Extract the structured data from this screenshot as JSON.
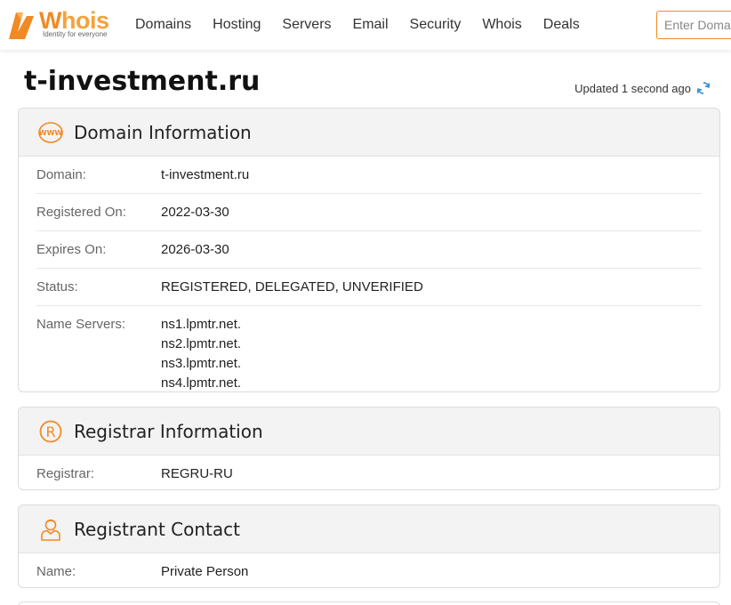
{
  "header": {
    "logo": {
      "brand": "Whois",
      "brand_w": "W",
      "brand_rest": "hois",
      "tagline": "Identity for everyone"
    },
    "nav": [
      {
        "label": "Domains"
      },
      {
        "label": "Hosting"
      },
      {
        "label": "Servers"
      },
      {
        "label": "Email"
      },
      {
        "label": "Security"
      },
      {
        "label": "Whois"
      },
      {
        "label": "Deals"
      }
    ],
    "search": {
      "placeholder": "Enter Domain or IP",
      "value": ""
    }
  },
  "page": {
    "title": "t-investment.ru",
    "updated": "Updated 1 second ago"
  },
  "domain_info": {
    "title": "Domain Information",
    "rows": [
      {
        "label": "Domain:",
        "value": "t-investment.ru"
      },
      {
        "label": "Registered On:",
        "value": "2022-03-30"
      },
      {
        "label": "Expires On:",
        "value": "2026-03-30"
      },
      {
        "label": "Status:",
        "value": "REGISTERED, DELEGATED, UNVERIFIED"
      }
    ],
    "name_servers": {
      "label": "Name Servers:",
      "values": [
        "ns1.lpmtr.net.",
        "ns2.lpmtr.net.",
        "ns3.lpmtr.net.",
        "ns4.lpmtr.net."
      ]
    }
  },
  "registrar_info": {
    "title": "Registrar Information",
    "rows": [
      {
        "label": "Registrar:",
        "value": "REGRU-RU"
      }
    ]
  },
  "registrant_contact": {
    "title": "Registrant Contact",
    "rows": [
      {
        "label": "Name:",
        "value": "Private Person"
      }
    ]
  },
  "colors": {
    "accent": "#f08a24",
    "refresh": "#2a8fd4",
    "card_header_bg": "#f3f3f3"
  },
  "icons": {
    "domain": "www-globe-icon",
    "registrar": "registered-icon",
    "registrant": "person-icon",
    "refresh": "refresh-icon"
  }
}
